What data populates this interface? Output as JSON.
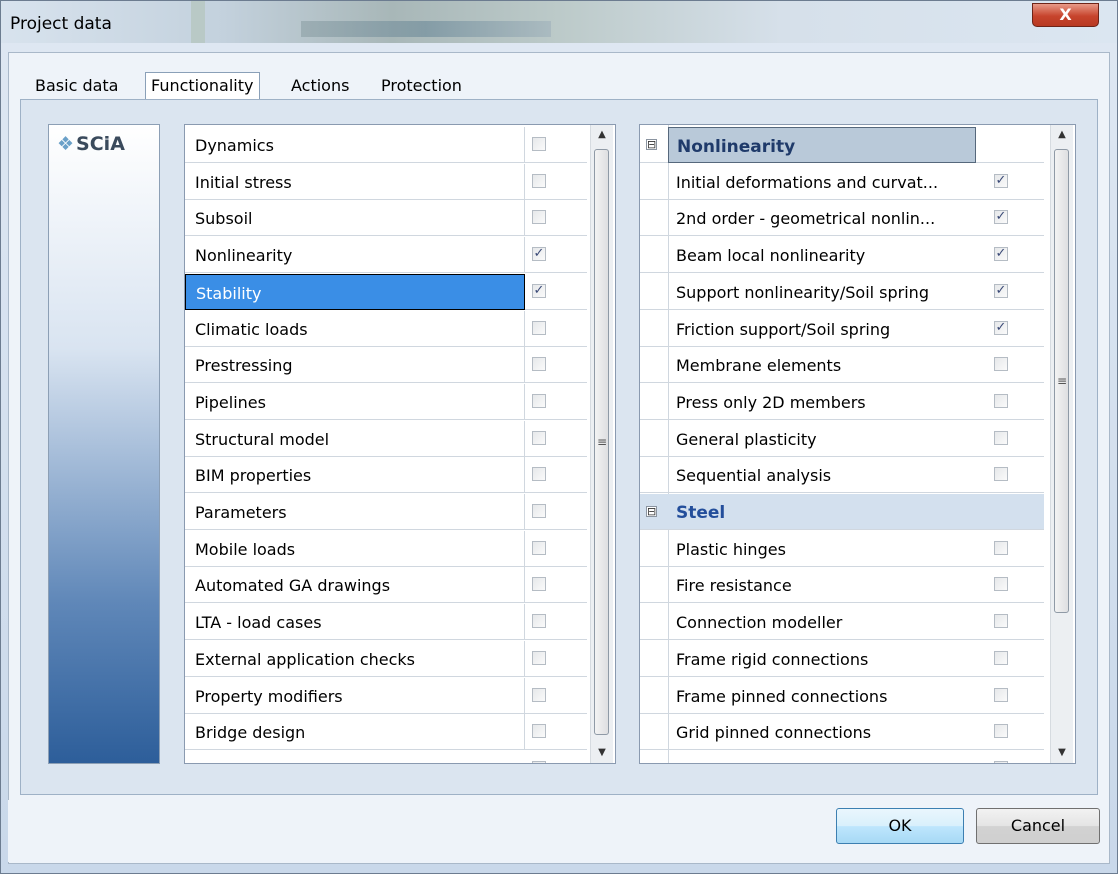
{
  "window": {
    "title": "Project data",
    "close_glyph": "X"
  },
  "tabs": [
    {
      "label": "Basic data",
      "active": false
    },
    {
      "label": "Functionality",
      "active": true
    },
    {
      "label": "Actions",
      "active": false
    },
    {
      "label": "Protection",
      "active": false
    }
  ],
  "logo": {
    "text": "SCiA",
    "mark_icon": "scia-logo-icon"
  },
  "left_list": {
    "items": [
      {
        "label": "Dynamics",
        "checked": false
      },
      {
        "label": "Initial stress",
        "checked": false
      },
      {
        "label": "Subsoil",
        "checked": false
      },
      {
        "label": "Nonlinearity",
        "checked": true
      },
      {
        "label": "Stability",
        "checked": true,
        "selected": true
      },
      {
        "label": "Climatic loads",
        "checked": false
      },
      {
        "label": "Prestressing",
        "checked": false
      },
      {
        "label": "Pipelines",
        "checked": false
      },
      {
        "label": "Structural model",
        "checked": false
      },
      {
        "label": "BIM properties",
        "checked": false
      },
      {
        "label": "Parameters",
        "checked": false
      },
      {
        "label": "Mobile loads",
        "checked": false
      },
      {
        "label": "Automated GA drawings",
        "checked": false
      },
      {
        "label": "LTA - load cases",
        "checked": false
      },
      {
        "label": "External application checks",
        "checked": false
      },
      {
        "label": "Property modifiers",
        "checked": false
      },
      {
        "label": "Bridge design",
        "checked": false
      }
    ]
  },
  "right_list": {
    "groups": [
      {
        "label": "Nonlinearity",
        "expander": "⊟",
        "items": [
          {
            "label": "Initial deformations and curvat...",
            "checked": true
          },
          {
            "label": "2nd order - geometrical nonlin...",
            "checked": true
          },
          {
            "label": "Beam local nonlinearity",
            "checked": true
          },
          {
            "label": "Support nonlinearity/Soil spring",
            "checked": true
          },
          {
            "label": "Friction support/Soil spring",
            "checked": true
          },
          {
            "label": "Membrane elements",
            "checked": false
          },
          {
            "label": "Press only 2D members",
            "checked": false
          },
          {
            "label": "General plasticity",
            "checked": false
          },
          {
            "label": "Sequential analysis",
            "checked": false
          }
        ]
      },
      {
        "label": "Steel",
        "expander": "⊟",
        "items": [
          {
            "label": "Plastic hinges",
            "checked": false
          },
          {
            "label": "Fire resistance",
            "checked": false
          },
          {
            "label": "Connection modeller",
            "checked": false
          },
          {
            "label": "Frame rigid connections",
            "checked": false
          },
          {
            "label": "Frame pinned connections",
            "checked": false
          },
          {
            "label": "Grid pinned connections",
            "checked": false
          }
        ]
      }
    ]
  },
  "scrollbar": {
    "up_glyph": "▲",
    "down_glyph": "▼",
    "grip_glyph": "≡"
  },
  "buttons": {
    "ok": "OK",
    "cancel": "Cancel"
  },
  "check_glyph": "✓"
}
